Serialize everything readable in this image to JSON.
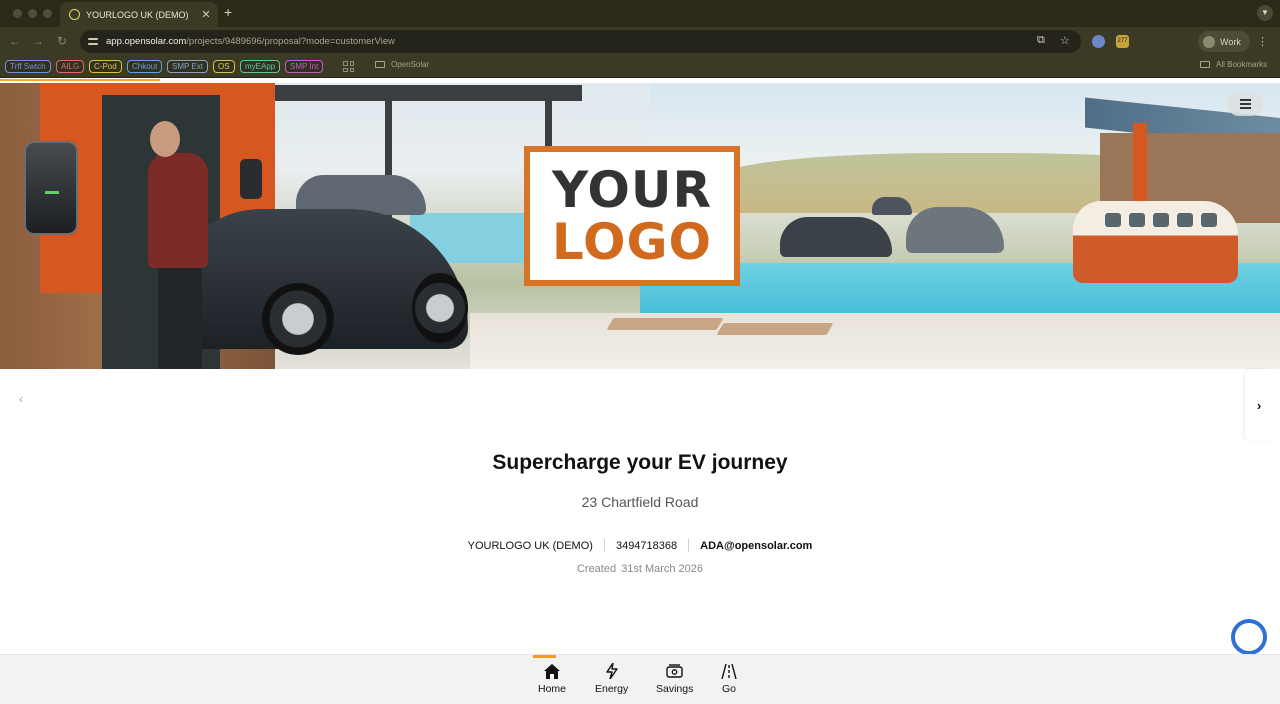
{
  "browser": {
    "tab_title": "YOURLOGO UK (DEMO)",
    "url_host": "app.opensolar.com",
    "url_path": "/projects/9489696/proposal?mode=customerView",
    "profile_label": "Work",
    "extension_badge": "277",
    "bookmarks": [
      {
        "label": "Trff Swtch",
        "color": "#7b8be0"
      },
      {
        "label": "AILG",
        "color": "#e06a6a"
      },
      {
        "label": "C-Pod",
        "color": "#d8c44b"
      },
      {
        "label": "Chkout",
        "color": "#6aa0e0"
      },
      {
        "label": "SMP Ext",
        "color": "#8aa2c8"
      },
      {
        "label": "OS",
        "color": "#d8c44b"
      },
      {
        "label": "myEApp",
        "color": "#5cc7a0"
      },
      {
        "label": "SMP Int",
        "color": "#c45fc4"
      }
    ],
    "bookmark_folder": "OpenSolar",
    "all_bookmarks": "All Bookmarks"
  },
  "hero": {
    "logo_line1": "YOUR",
    "logo_line2": "LOGO"
  },
  "proposal": {
    "headline": "Supercharge your EV journey",
    "address": "23 Chartfield Road",
    "company": "YOURLOGO UK (DEMO)",
    "phone": "3494718368",
    "email": "ADA@opensolar.com",
    "created_label": "Created",
    "created_date": "31st March 2026"
  },
  "bottom_nav": {
    "items": [
      {
        "label": "Home",
        "icon": "home-icon",
        "active": true
      },
      {
        "label": "Energy",
        "icon": "lightning-icon"
      },
      {
        "label": "Savings",
        "icon": "savings-icon"
      },
      {
        "label": "Go",
        "icon": "road-icon"
      }
    ]
  }
}
